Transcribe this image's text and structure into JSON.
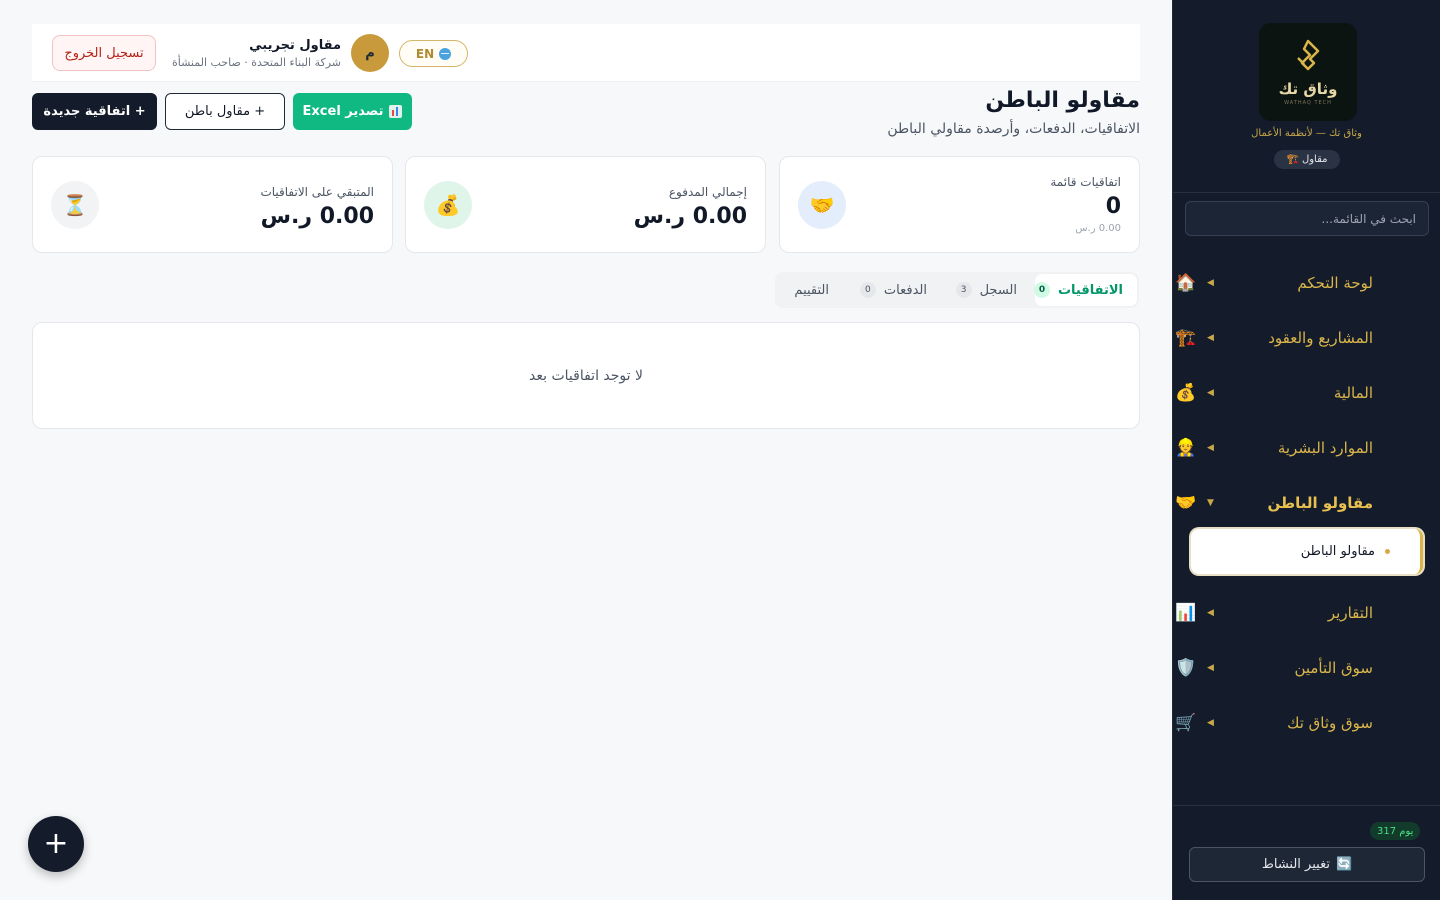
{
  "sidebar": {
    "logo_text": "وثاق تك",
    "logo_sub": "WATHAQ TECH",
    "tagline": "وثاق تك — لأنظمة الأعمال",
    "role_badge": "مقاول",
    "role_icon": "crane-icon",
    "search_placeholder": "ابحث في القائمة...",
    "nav": [
      {
        "label": "لوحة التحكم",
        "icon": "house-icon",
        "glyph": "🏠"
      },
      {
        "label": "المشاريع والعقود",
        "icon": "crane-icon",
        "glyph": "🏗️"
      },
      {
        "label": "المالية",
        "icon": "money-bag-icon",
        "glyph": "💰"
      },
      {
        "label": "الموارد البشرية",
        "icon": "person-icon",
        "glyph": "👷"
      },
      {
        "label": "مقاولو الباطن",
        "icon": "handshake-icon",
        "glyph": "🤝"
      },
      {
        "label": "التقارير",
        "icon": "bar-chart-icon",
        "glyph": "📊"
      },
      {
        "label": "سوق التأمين",
        "icon": "shield-icon",
        "glyph": "🛡️"
      },
      {
        "label": "سوق وثاق تك",
        "icon": "cart-icon",
        "glyph": "🛒"
      }
    ],
    "sub_item": "مقاولو الباطن",
    "days_badge": "317 يوم",
    "switch_label": "تغيير النشاط",
    "switch_icon": "refresh-icon"
  },
  "header": {
    "logout": "تسجيل الخروج",
    "user_name": "مقاول تجريبي",
    "user_sub": "شركة البناء المتحدة · صاحب المنشأة",
    "avatar_initial": "م",
    "lang": "EN"
  },
  "page": {
    "title": "مقاولو الباطن",
    "subtitle": "الاتفاقيات، الدفعات، وأرصدة مقاولي الباطن",
    "btn_new": "+ اتفاقية جديدة",
    "btn_sub": "+ مقاول باطن",
    "btn_excel": "تصدير Excel"
  },
  "cards": [
    {
      "label": "اتفاقيات قائمة",
      "value": "0",
      "foot": "0.00 ر.س",
      "icon": "handshake-icon",
      "glyph": "🤝"
    },
    {
      "label": "إجمالي المدفوع",
      "value": "0.00 ر.س",
      "icon": "money-bag-icon",
      "glyph": "💰"
    },
    {
      "label": "المتبقي على الاتفاقيات",
      "value": "0.00 ر.س",
      "icon": "hourglass-icon",
      "glyph": "⏳"
    }
  ],
  "tabs": [
    {
      "label": "الاتفاقيات",
      "count": "0"
    },
    {
      "label": "السجل",
      "count": "3"
    },
    {
      "label": "الدفعات",
      "count": "0"
    },
    {
      "label": "التقييم"
    }
  ],
  "empty_text": "لا توجد اتفاقيات بعد",
  "fab": "+",
  "colors": {
    "sidebar_bg": "#141c2b",
    "gold": "#d9b54a",
    "accent_green": "#10b981",
    "danger": "#b42318"
  }
}
